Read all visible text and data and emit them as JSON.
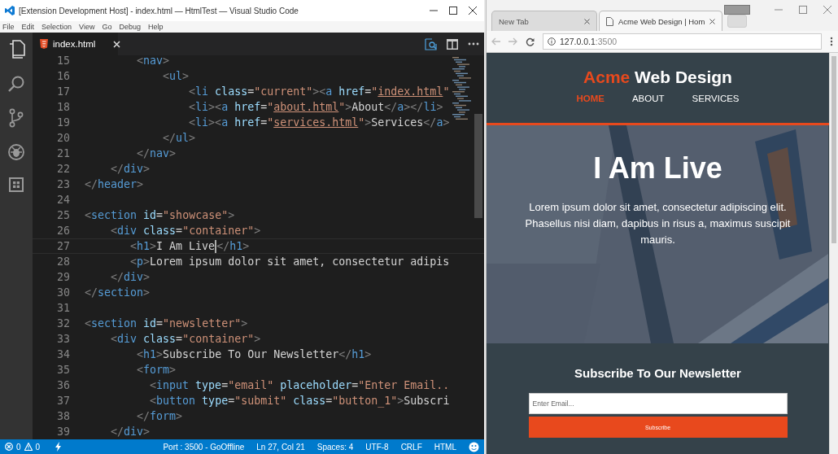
{
  "vscode": {
    "window": {
      "title": "[Extension Development Host] - index.html — HtmlTest — Visual Studio Code"
    },
    "menu": [
      "File",
      "Edit",
      "Selection",
      "View",
      "Go",
      "Debug",
      "Help"
    ],
    "tabs": [
      {
        "label": "index.html",
        "selected": true
      }
    ],
    "code": {
      "lines": [
        {
          "number": "15",
          "current": false,
          "tokens": [
            {
              "kind": "punct",
              "text": "        <"
            },
            {
              "kind": "tag",
              "text": "nav"
            },
            {
              "kind": "punct",
              "text": ">"
            }
          ]
        },
        {
          "number": "16",
          "current": false,
          "tokens": [
            {
              "kind": "punct",
              "text": "            <"
            },
            {
              "kind": "tag",
              "text": "ul"
            },
            {
              "kind": "punct",
              "text": ">"
            }
          ]
        },
        {
          "number": "17",
          "current": false,
          "tokens": [
            {
              "kind": "punct",
              "text": "                <"
            },
            {
              "kind": "tag",
              "text": "li"
            },
            {
              "kind": "attr",
              "text": " class"
            },
            {
              "kind": "text",
              "text": "="
            },
            {
              "kind": "string",
              "text": "\"current\""
            },
            {
              "kind": "punct",
              "text": "><"
            },
            {
              "kind": "tag",
              "text": "a"
            },
            {
              "kind": "attr",
              "text": " href"
            },
            {
              "kind": "text",
              "text": "="
            },
            {
              "kind": "string",
              "text": "\""
            },
            {
              "kind": "link",
              "text": "index.html"
            },
            {
              "kind": "string",
              "text": "\""
            }
          ]
        },
        {
          "number": "18",
          "current": false,
          "tokens": [
            {
              "kind": "punct",
              "text": "                <"
            },
            {
              "kind": "tag",
              "text": "li"
            },
            {
              "kind": "punct",
              "text": "><"
            },
            {
              "kind": "tag",
              "text": "a"
            },
            {
              "kind": "attr",
              "text": " href"
            },
            {
              "kind": "text",
              "text": "="
            },
            {
              "kind": "string",
              "text": "\""
            },
            {
              "kind": "link",
              "text": "about.html"
            },
            {
              "kind": "string",
              "text": "\""
            },
            {
              "kind": "punct",
              "text": ">"
            },
            {
              "kind": "text",
              "text": "About"
            },
            {
              "kind": "punct",
              "text": "</"
            },
            {
              "kind": "tag",
              "text": "a"
            },
            {
              "kind": "punct",
              "text": "></"
            },
            {
              "kind": "tag",
              "text": "li"
            },
            {
              "kind": "punct",
              "text": ">"
            }
          ]
        },
        {
          "number": "19",
          "current": false,
          "tokens": [
            {
              "kind": "punct",
              "text": "                <"
            },
            {
              "kind": "tag",
              "text": "li"
            },
            {
              "kind": "punct",
              "text": "><"
            },
            {
              "kind": "tag",
              "text": "a"
            },
            {
              "kind": "attr",
              "text": " href"
            },
            {
              "kind": "text",
              "text": "="
            },
            {
              "kind": "string",
              "text": "\""
            },
            {
              "kind": "link",
              "text": "services.html"
            },
            {
              "kind": "string",
              "text": "\""
            },
            {
              "kind": "punct",
              "text": ">"
            },
            {
              "kind": "text",
              "text": "Services"
            },
            {
              "kind": "punct",
              "text": "</"
            },
            {
              "kind": "tag",
              "text": "a"
            },
            {
              "kind": "punct",
              "text": ">"
            }
          ]
        },
        {
          "number": "20",
          "current": false,
          "tokens": [
            {
              "kind": "punct",
              "text": "            </"
            },
            {
              "kind": "tag",
              "text": "ul"
            },
            {
              "kind": "punct",
              "text": ">"
            }
          ]
        },
        {
          "number": "21",
          "current": false,
          "tokens": [
            {
              "kind": "punct",
              "text": "        </"
            },
            {
              "kind": "tag",
              "text": "nav"
            },
            {
              "kind": "punct",
              "text": ">"
            }
          ]
        },
        {
          "number": "22",
          "current": false,
          "tokens": [
            {
              "kind": "punct",
              "text": "    </"
            },
            {
              "kind": "tag",
              "text": "div"
            },
            {
              "kind": "punct",
              "text": ">"
            }
          ]
        },
        {
          "number": "23",
          "current": false,
          "tokens": [
            {
              "kind": "punct",
              "text": "</"
            },
            {
              "kind": "tag",
              "text": "header"
            },
            {
              "kind": "punct",
              "text": ">"
            }
          ]
        },
        {
          "number": "24",
          "current": false
        },
        {
          "number": "25",
          "current": false,
          "tokens": [
            {
              "kind": "punct",
              "text": "<"
            },
            {
              "kind": "tag",
              "text": "section"
            },
            {
              "kind": "attr",
              "text": " id"
            },
            {
              "kind": "text",
              "text": "="
            },
            {
              "kind": "string",
              "text": "\"showcase\""
            },
            {
              "kind": "punct",
              "text": ">"
            }
          ]
        },
        {
          "number": "26",
          "current": false,
          "tokens": [
            {
              "kind": "punct",
              "text": "    <"
            },
            {
              "kind": "tag",
              "text": "div"
            },
            {
              "kind": "attr",
              "text": " class"
            },
            {
              "kind": "text",
              "text": "="
            },
            {
              "kind": "string",
              "text": "\"container\""
            },
            {
              "kind": "punct",
              "text": ">"
            }
          ]
        },
        {
          "number": "27",
          "current": true,
          "tokens": [
            {
              "kind": "punct",
              "text": "       <"
            },
            {
              "kind": "tag",
              "text": "h1"
            },
            {
              "kind": "punct",
              "text": ">"
            },
            {
              "kind": "text",
              "text": "I Am Live"
            },
            {
              "kind": "punct",
              "text": "</"
            },
            {
              "kind": "tag",
              "text": "h1"
            },
            {
              "kind": "punct",
              "text": ">"
            }
          ]
        },
        {
          "number": "28",
          "current": false,
          "tokens": [
            {
              "kind": "punct",
              "text": "       <"
            },
            {
              "kind": "tag",
              "text": "p"
            },
            {
              "kind": "punct",
              "text": ">"
            },
            {
              "kind": "text",
              "text": "Lorem ipsum dolor sit amet, consectetur adipis"
            }
          ]
        },
        {
          "number": "29",
          "current": false,
          "tokens": [
            {
              "kind": "punct",
              "text": "    </"
            },
            {
              "kind": "tag",
              "text": "div"
            },
            {
              "kind": "punct",
              "text": ">"
            }
          ]
        },
        {
          "number": "30",
          "current": false,
          "tokens": [
            {
              "kind": "punct",
              "text": "</"
            },
            {
              "kind": "tag",
              "text": "section"
            },
            {
              "kind": "punct",
              "text": ">"
            }
          ]
        },
        {
          "number": "31",
          "current": false
        },
        {
          "number": "32",
          "current": false,
          "tokens": [
            {
              "kind": "punct",
              "text": "<"
            },
            {
              "kind": "tag",
              "text": "section"
            },
            {
              "kind": "attr",
              "text": " id"
            },
            {
              "kind": "text",
              "text": "="
            },
            {
              "kind": "string",
              "text": "\"newsletter\""
            },
            {
              "kind": "punct",
              "text": ">"
            }
          ]
        },
        {
          "number": "33",
          "current": false,
          "tokens": [
            {
              "kind": "punct",
              "text": "    <"
            },
            {
              "kind": "tag",
              "text": "div"
            },
            {
              "kind": "attr",
              "text": " class"
            },
            {
              "kind": "text",
              "text": "="
            },
            {
              "kind": "string",
              "text": "\"container\""
            },
            {
              "kind": "punct",
              "text": ">"
            }
          ]
        },
        {
          "number": "34",
          "current": false,
          "tokens": [
            {
              "kind": "punct",
              "text": "        <"
            },
            {
              "kind": "tag",
              "text": "h1"
            },
            {
              "kind": "punct",
              "text": ">"
            },
            {
              "kind": "text",
              "text": "Subscribe To Our Newsletter"
            },
            {
              "kind": "punct",
              "text": "</"
            },
            {
              "kind": "tag",
              "text": "h1"
            },
            {
              "kind": "punct",
              "text": ">"
            }
          ]
        },
        {
          "number": "35",
          "current": false,
          "tokens": [
            {
              "kind": "punct",
              "text": "        <"
            },
            {
              "kind": "tag",
              "text": "form"
            },
            {
              "kind": "punct",
              "text": ">"
            }
          ]
        },
        {
          "number": "36",
          "current": false,
          "tokens": [
            {
              "kind": "punct",
              "text": "          <"
            },
            {
              "kind": "tag",
              "text": "input"
            },
            {
              "kind": "attr",
              "text": " type"
            },
            {
              "kind": "text",
              "text": "="
            },
            {
              "kind": "string",
              "text": "\"email\""
            },
            {
              "kind": "attr",
              "text": " placeholder"
            },
            {
              "kind": "text",
              "text": "="
            },
            {
              "kind": "string",
              "text": "\"Enter Email.."
            }
          ]
        },
        {
          "number": "37",
          "current": false,
          "tokens": [
            {
              "kind": "punct",
              "text": "          <"
            },
            {
              "kind": "tag",
              "text": "button"
            },
            {
              "kind": "attr",
              "text": " type"
            },
            {
              "kind": "text",
              "text": "="
            },
            {
              "kind": "string",
              "text": "\"submit\""
            },
            {
              "kind": "attr",
              "text": " class"
            },
            {
              "kind": "text",
              "text": "="
            },
            {
              "kind": "string",
              "text": "\"button_1\""
            },
            {
              "kind": "punct",
              "text": ">"
            },
            {
              "kind": "text",
              "text": "Subscri"
            }
          ]
        },
        {
          "number": "38",
          "current": false,
          "tokens": [
            {
              "kind": "punct",
              "text": "        </"
            },
            {
              "kind": "tag",
              "text": "form"
            },
            {
              "kind": "punct",
              "text": ">"
            }
          ]
        },
        {
          "number": "39",
          "current": false,
          "tokens": [
            {
              "kind": "punct",
              "text": "    </"
            },
            {
              "kind": "tag",
              "text": "div"
            },
            {
              "kind": "punct",
              "text": ">"
            }
          ]
        }
      ]
    },
    "status_bar": {
      "errors": "0",
      "warnings": "0",
      "items": [
        "Port : 3500 - GoOffline",
        "Ln 27, Col 21",
        "Spaces: 4",
        "UTF-8",
        "CRLF",
        "HTML"
      ]
    }
  },
  "browser": {
    "tabs": [
      {
        "label": "New Tab",
        "selected": false
      },
      {
        "label": "Acme Web Design | Hom",
        "selected": true
      }
    ],
    "url": {
      "host": "127.0.0.1",
      "port": ":3500"
    },
    "page": {
      "brand": {
        "highlight": "Acme",
        "rest": "Web Design"
      },
      "nav": [
        {
          "label": "HOME",
          "selected": true
        },
        {
          "label": "ABOUT",
          "selected": false
        },
        {
          "label": "SERVICES",
          "selected": false
        }
      ],
      "showcase": {
        "kind": "picture",
        "title": "I Am Live",
        "text": "Lorem ipsum dolor sit amet, consectetur adipiscing elit. Phasellus nisi diam, dapibus in risus a, maximus suscipit mauris."
      },
      "newsletter": {
        "title": "Subscribe To Our Newsletter",
        "placeholder": "Enter Email...",
        "button": "Subscribe"
      }
    }
  }
}
